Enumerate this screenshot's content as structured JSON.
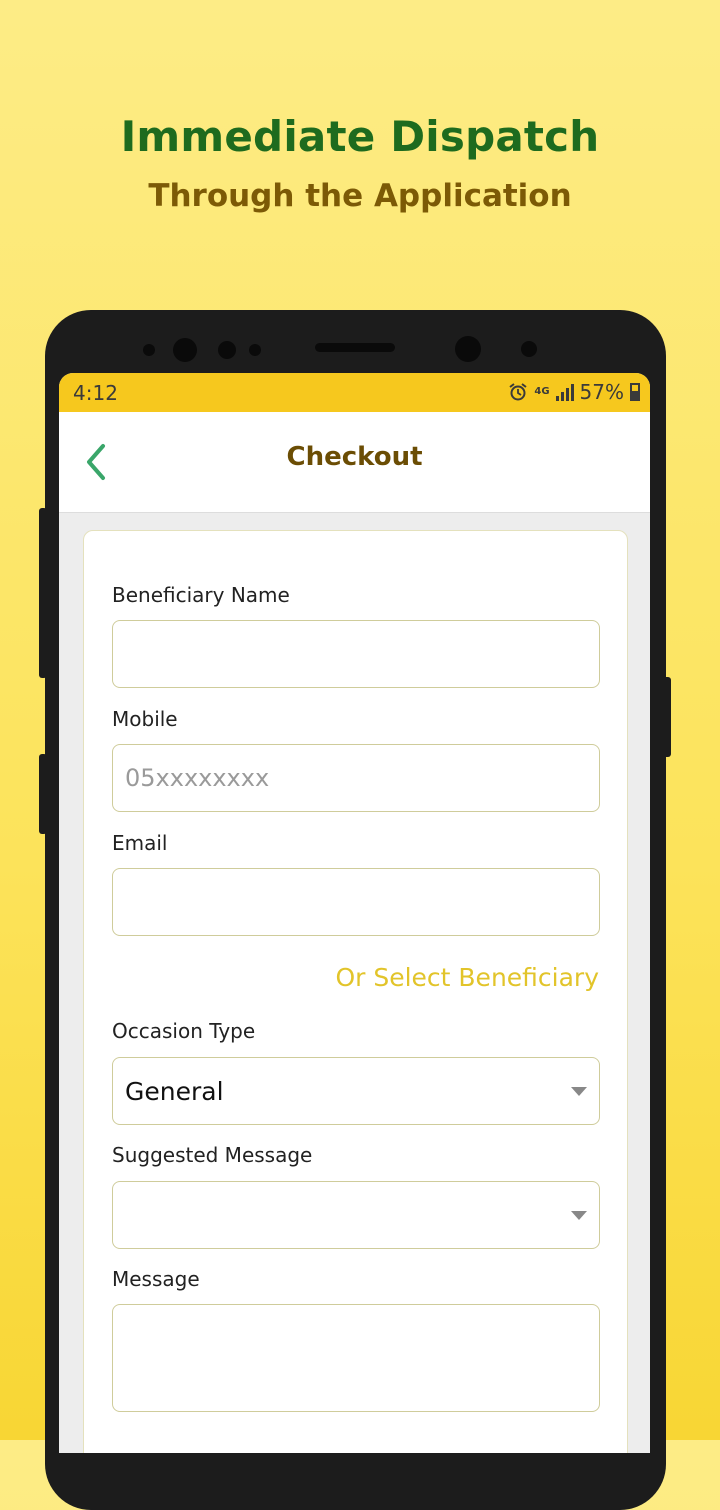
{
  "promo": {
    "title": "Immediate Dispatch",
    "subtitle": "Through the Application"
  },
  "status_bar": {
    "time": "4:12",
    "network": "4G",
    "battery": "57%"
  },
  "header": {
    "title": "Checkout"
  },
  "form": {
    "beneficiary_name": {
      "label": "Beneficiary Name",
      "value": "",
      "placeholder": ""
    },
    "mobile": {
      "label": "Mobile",
      "value": "",
      "placeholder": "05xxxxxxxx"
    },
    "email": {
      "label": "Email",
      "value": "",
      "placeholder": ""
    },
    "select_beneficiary_link": "Or Select Beneficiary",
    "occasion_type": {
      "label": "Occasion Type",
      "value": "General"
    },
    "suggested_message": {
      "label": "Suggested Message",
      "value": ""
    },
    "message": {
      "label": "Message",
      "value": ""
    }
  },
  "colors": {
    "accent_yellow": "#f6c81e",
    "title_green": "#1e6b1e",
    "title_brown": "#6b4d04",
    "link_yellow": "#e2c42a",
    "back_green": "#3aa66a"
  }
}
